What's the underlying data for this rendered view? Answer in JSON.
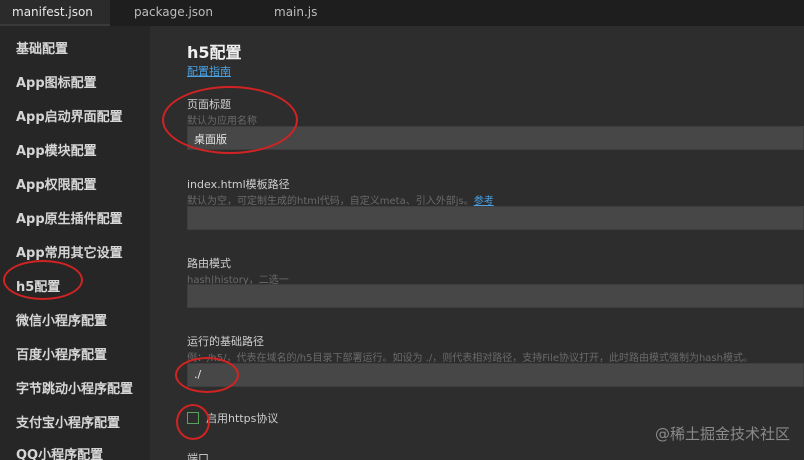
{
  "tabs": [
    "manifest.json",
    "package.json",
    "main.js"
  ],
  "sidebar": {
    "items": [
      "基础配置",
      "App图标配置",
      "App启动界面配置",
      "App模块配置",
      "App权限配置",
      "App原生插件配置",
      "App常用其它设置",
      "h5配置",
      "微信小程序配置",
      "百度小程序配置",
      "字节跳动小程序配置",
      "支付宝小程序配置",
      "QQ小程序配置"
    ]
  },
  "main": {
    "title": "h5配置",
    "guide_link": "配置指南",
    "page_title": {
      "label": "页面标题",
      "hint": "默认为应用名称",
      "value": "桌面版"
    },
    "index_template": {
      "label": "index.html模板路径",
      "hint": "默认为空，可定制生成的html代码，自定义meta、引入外部js。",
      "hint_link": "参考",
      "value": ""
    },
    "router_mode": {
      "label": "路由模式",
      "hint": "hash|history，二选一",
      "value": ""
    },
    "base_path": {
      "label": "运行的基础路径",
      "hint": "例：/h5/，代表在域名的/h5目录下部署运行。如设为 ./，则代表相对路径，支持File协议打开，此时路由模式强制为hash模式。",
      "value": "./"
    },
    "https": {
      "label": "启用https协议",
      "checked": false
    },
    "port_label": "端口"
  },
  "watermark": "@稀土掘金技术社区",
  "colors": {
    "annotation": "#d22323",
    "link": "#4aa3e6"
  }
}
